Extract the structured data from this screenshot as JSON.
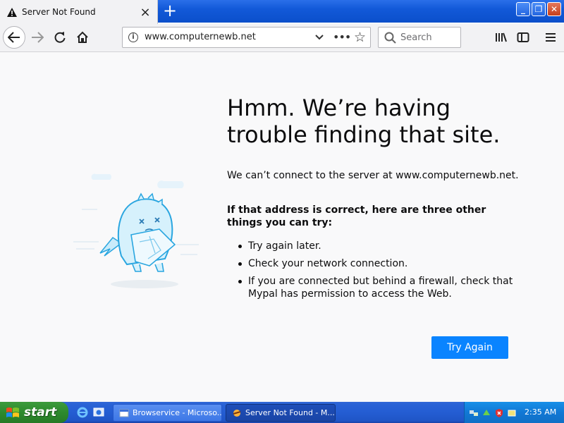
{
  "tab": {
    "title": "Server Not Found",
    "close": "×",
    "new_tab": "+"
  },
  "window": {
    "minimize": "_",
    "restore": "❐",
    "close": "✕"
  },
  "navbar": {
    "url": "www.computernewb.net",
    "search_placeholder": "Search",
    "more": "•••"
  },
  "error": {
    "title": "Hmm. We’re having trouble finding that site.",
    "message": "We can’t connect to the server at www.computernewb.net.",
    "subtitle": "If that address is correct, here are three other things you can try:",
    "items": [
      "Try again later.",
      "Check your network connection.",
      "If you are connected but behind a firewall, check that Mypal has permission to access the Web."
    ],
    "button": "Try Again"
  },
  "taskbar": {
    "start_label": "start",
    "items": [
      {
        "label": "Browservice - Microso..."
      },
      {
        "label": "Server Not Found - M..."
      }
    ],
    "clock": "2:35 AM"
  },
  "colors": {
    "accent": "#0a84ff",
    "xp_blue": "#245dd3",
    "start_green": "#2d8a2d"
  }
}
